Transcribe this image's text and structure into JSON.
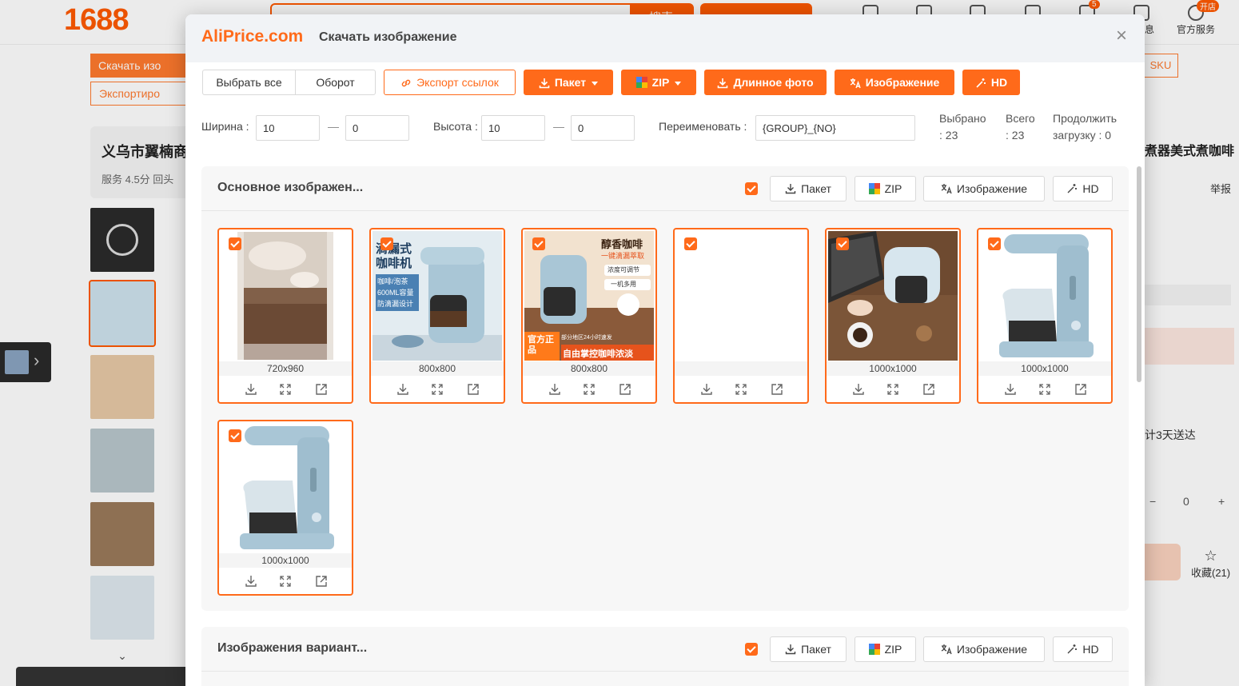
{
  "background": {
    "logo": "1688",
    "search_button": "搜索",
    "nav": [
      {
        "label": "",
        "icon": "home-icon"
      },
      {
        "label": "",
        "icon": "message-icon"
      },
      {
        "label": "",
        "icon": "puzzle-icon"
      },
      {
        "label": "",
        "icon": "clipboard-icon"
      },
      {
        "label": "",
        "icon": "cart-icon",
        "badge": "5"
      },
      {
        "label": "息",
        "icon": "chat-icon"
      },
      {
        "label": "官方服务",
        "icon": "user-icon",
        "badge": "开店"
      }
    ],
    "download_btn": "Скачать изо",
    "export_btn": "Экспортиро",
    "shop_name": "义乌市翼楠商",
    "shop_rating": "服务 4.5分  回头",
    "sku_btn": "SKU",
    "product_title": "煮器美式煮咖啡",
    "report": "举报",
    "delivery": "计3天送达",
    "quantity": "0",
    "qty_minus": "−",
    "qty_plus": "+",
    "favorites": "收藏(21)"
  },
  "modal": {
    "logo": "AliPrice.com",
    "title": "Скачать изображение",
    "toolbar": {
      "select_all": "Выбрать все",
      "invert": "Оборот",
      "export_links": "Экспорт ссылок",
      "batch": "Пакет",
      "zip": "ZIP",
      "long_photo": "Длинное фото",
      "image": "Изображение",
      "hd": "HD"
    },
    "filters": {
      "width_label": "Ширина :",
      "width_min": "10",
      "width_max": "0",
      "height_label": "Высота :",
      "height_min": "10",
      "height_max": "0",
      "rename_label": "Переименовать :",
      "rename_value": "{GROUP}_{NO}",
      "selected_label": "Выбрано",
      "selected_value": ": 23",
      "total_label": "Всего",
      "total_value": ": 23",
      "continue_label": "Продолжить",
      "continue_value": "загрузку : 0"
    },
    "sections": [
      {
        "title": "Основное изображен...",
        "checked": true,
        "batch": "Пакет",
        "zip": "ZIP",
        "image": "Изображение",
        "hd": "HD",
        "images": [
          {
            "size": "720x960",
            "kind": "coffee-grounds"
          },
          {
            "size": "800x800",
            "kind": "drip-coffee-poster",
            "caption_top": "滴漏式",
            "caption_top2": "咖啡机",
            "features": [
              "咖啡/泡茶",
              "600ML容量",
              "防滴漏设计"
            ]
          },
          {
            "size": "800x800",
            "kind": "aroma-coffee-poster",
            "caption_top": "醇香咖啡",
            "caption_sub": "一键滴漏萃取",
            "features": [
              "浓度可调节",
              "一机多用"
            ],
            "badge": "官方正品",
            "banner": "自由掌控咖啡浓淡",
            "small": "部分地区24小时速发"
          },
          {
            "size": "",
            "kind": "blank"
          },
          {
            "size": "1000x1000",
            "kind": "laptop-desk"
          },
          {
            "size": "1000x1000",
            "kind": "coffee-maker"
          },
          {
            "size": "1000x1000",
            "kind": "coffee-maker"
          }
        ]
      },
      {
        "title": "Изображения вариант...",
        "checked": true,
        "batch": "Пакет",
        "zip": "ZIP",
        "image": "Изображение",
        "hd": "HD"
      }
    ],
    "colors": {
      "accent": "#ff6a1a",
      "brand_1688": "#ff5a00"
    }
  }
}
